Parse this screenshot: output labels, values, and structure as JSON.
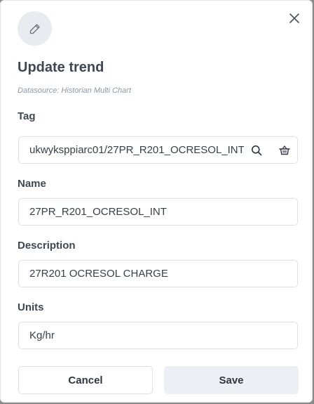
{
  "dialog": {
    "title": "Update trend",
    "subtitle": "Datasource: Historian Multi Chart"
  },
  "icons": {
    "header": "pencil-icon",
    "close": "close-icon",
    "tag_search": "search-icon",
    "tag_browse": "basket-icon"
  },
  "fields": {
    "tag": {
      "label": "Tag",
      "value": "ukwyksppiarc01/27PR_R201_OCRESOL_INT"
    },
    "name": {
      "label": "Name",
      "value": "27PR_R201_OCRESOL_INT"
    },
    "description": {
      "label": "Description",
      "value": "27R201 OCRESOL CHARGE"
    },
    "units": {
      "label": "Units",
      "value": "Kg/hr"
    }
  },
  "actions": {
    "cancel_label": "Cancel",
    "save_label": "Save"
  },
  "colors": {
    "title": "#3f4754",
    "subtitle": "#8f98a6",
    "border": "#dde1e6",
    "save_bg": "#eceff3"
  }
}
